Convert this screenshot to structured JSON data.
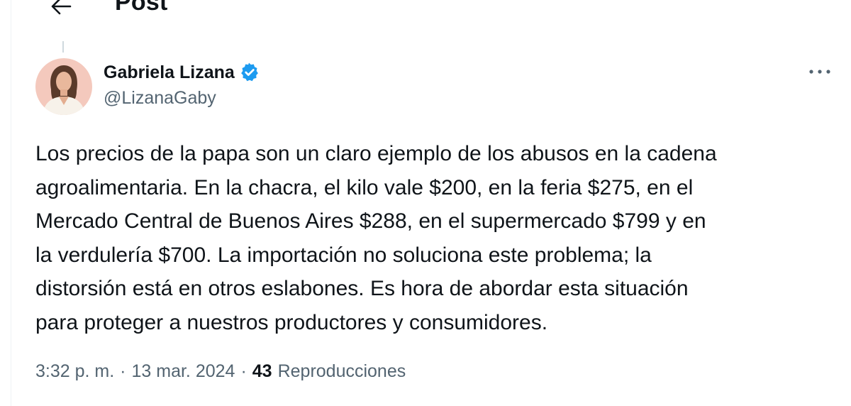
{
  "header": {
    "title": "Post"
  },
  "post": {
    "author": {
      "display_name": "Gabriela Lizana",
      "handle": "@LizanaGaby",
      "verified": true
    },
    "text": "Los precios de la papa son un claro ejemplo de los abusos en la cadena\nagroalimentaria. En la chacra, el kilo vale $200, en la feria $275, en el\nMercado Central de Buenos Aires $288, en el supermercado $799 y en\nla verdulería $700. La importación no soluciona este problema; la\ndistorsión está en otros eslabones. Es hora de abordar esta situación\npara proteger a nuestros productores y consumidores.",
    "time": "3:32 p. m.",
    "separator": "·",
    "date": "13 mar. 2024",
    "views_count": "43",
    "views_label": "Reproducciones"
  },
  "icons": {
    "back": "arrow-left-icon",
    "verified": "verified-badge-icon",
    "more": "more-horizontal-icon"
  },
  "colors": {
    "text_primary": "#0f1419",
    "text_secondary": "#536471",
    "verified_blue": "#1d9bf0",
    "avatar_bg": "#f4c9bd"
  }
}
